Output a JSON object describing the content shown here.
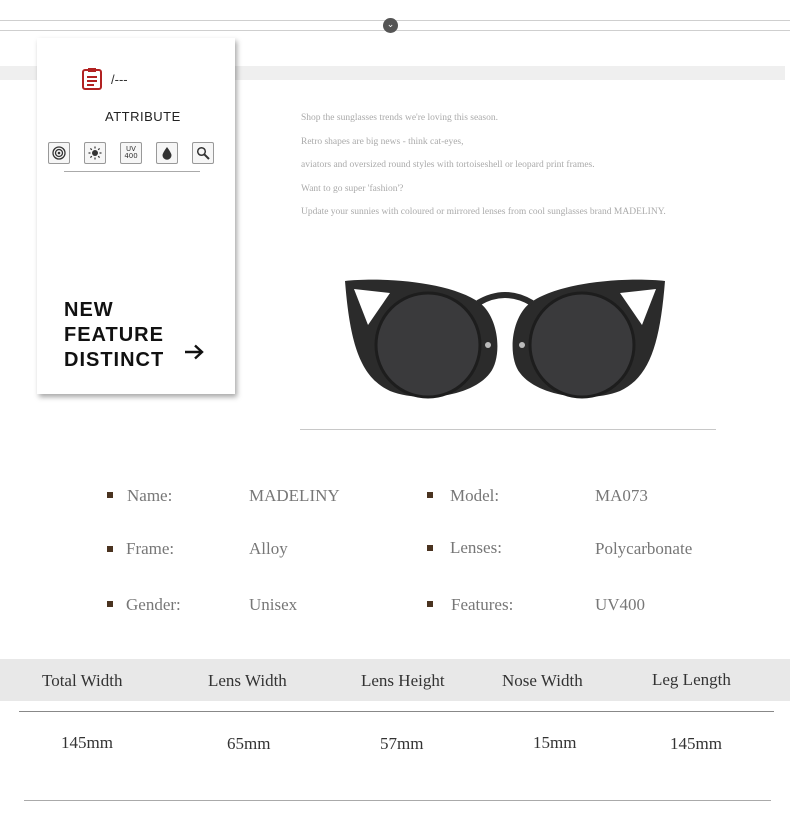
{
  "card": {
    "slash_label": "/---",
    "attribute_title": "ATTRIBUTE",
    "icons": [
      "target-icon",
      "sun-icon",
      "uv400-icon",
      "drop-icon",
      "magnifier-icon"
    ],
    "uv_label": "UV\n400",
    "feature_lines": [
      "NEW",
      "FEATURE",
      "DISTINCT"
    ]
  },
  "intro": [
    "Shop the sunglasses trends we're loving this season.",
    "Retro shapes are big news - think cat-eyes,",
    "aviators and oversized round styles with tortoiseshell or leopard print frames.",
    "Want to go super 'fashion'?",
    "Update your sunnies with coloured or mirrored lenses from cool sunglasses brand MADELINY."
  ],
  "specs": [
    {
      "label": "Name:",
      "value": "MADELINY"
    },
    {
      "label": "Model:",
      "value": "MA073"
    },
    {
      "label": "Frame:",
      "value": "Alloy"
    },
    {
      "label": "Lenses:",
      "value": "Polycarbonate"
    },
    {
      "label": "Gender:",
      "value": "Unisex"
    },
    {
      "label": "Features:",
      "value": "UV400"
    }
  ],
  "sizes": {
    "headers": [
      "Total Width",
      "Lens Width",
      "Lens Height",
      "Nose Width",
      "Leg Length"
    ],
    "values": [
      "145mm",
      "65mm",
      "57mm",
      "15mm",
      "145mm"
    ]
  },
  "colors": {
    "bullet": "#4a3320",
    "header_bg": "#e8e8e8",
    "frame": "#2a2a2a"
  }
}
